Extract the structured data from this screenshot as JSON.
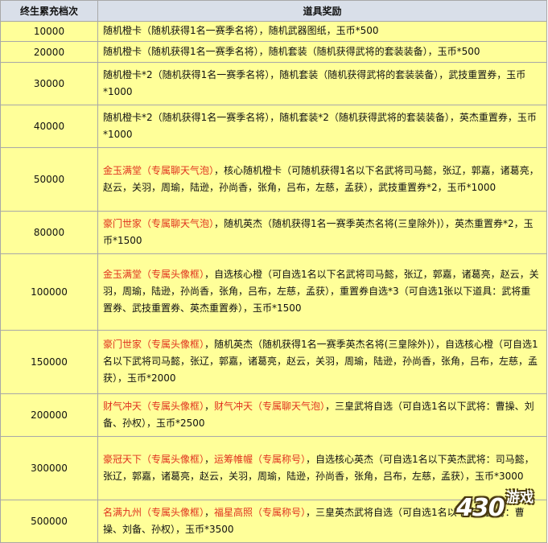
{
  "table": {
    "headers": {
      "tier": "终生累充档次",
      "reward": "道具奖励"
    },
    "rows": [
      {
        "tier": "10000",
        "parts": [
          {
            "t": "随机橙卡（随机获得1名一赛季名将），随机武器图纸，玉币*500"
          }
        ]
      },
      {
        "tier": "20000",
        "parts": [
          {
            "t": "随机橙卡（随机获得1名一赛季名将），随机套装（随机获得武将的套装装备），玉币*500"
          }
        ]
      },
      {
        "tier": "30000",
        "parts": [
          {
            "t": "随机橙卡*2（随机获得1名一赛季名将），随机套装（随机获得武将的套装装备），武技重置券，玉币*1000"
          }
        ]
      },
      {
        "tier": "40000",
        "parts": [
          {
            "t": "随机橙卡*2（随机获得1名一赛季名将），随机套装*2（随机获得武将的套装装备），英杰重置券，玉币*1000"
          }
        ]
      },
      {
        "tier": "50000",
        "parts": [
          {
            "t": "金玉满堂（专属聊天气泡）",
            "hl": true
          },
          {
            "t": "，核心随机橙卡（可随机获得1名以下名武将司马懿，张辽，郭嘉，诸葛亮，赵云，关羽，周瑜，陆逊，孙尚香，张角，吕布，左慈，孟获），武技重置券*2，玉币*1000"
          }
        ]
      },
      {
        "tier": "80000",
        "parts": [
          {
            "t": "豪门世家（专属聊天气泡）",
            "hl": true
          },
          {
            "t": "，随机英杰（随机获得1名一赛季英杰名将(三皇除外)），英杰重置券*2，玉币*1500"
          }
        ]
      },
      {
        "tier": "100000",
        "parts": [
          {
            "t": "金玉满堂（专属头像框）",
            "hl": true
          },
          {
            "t": "，自选核心橙（可自选1名以下名武将司马懿，张辽，郭嘉，诸葛亮，赵云，关羽，周瑜，陆逊，孙尚香，张角，吕布，左慈，孟获），重置券自选*3（可自选1张以下道具：武将重置券、武技重置券、英杰重置券），玉币*1500"
          }
        ]
      },
      {
        "tier": "150000",
        "parts": [
          {
            "t": "豪门世家（专属头像框）",
            "hl": true
          },
          {
            "t": "，随机英杰（随机获得1名一赛季英杰名将(三皇除外)），自选核心橙（可自选1名以下武将司马懿，张辽，郭嘉，诸葛亮，赵云，关羽，周瑜，陆逊，孙尚香，张角，吕布，左慈，孟获），玉币*2000"
          }
        ]
      },
      {
        "tier": "200000",
        "parts": [
          {
            "t": "财气冲天（专属头像框）",
            "hl": true
          },
          {
            "t": "，"
          },
          {
            "t": "财气冲天（专属聊天气泡）",
            "hl": true
          },
          {
            "t": "，三皇武将自选（可自选1名以下武将：曹操、刘备、孙权），玉币*2500"
          }
        ]
      },
      {
        "tier": "300000",
        "parts": [
          {
            "t": "豪冠天下（专属头像框）",
            "hl": true
          },
          {
            "t": "，"
          },
          {
            "t": "运筹帷幄（专属称号）",
            "hl": true
          },
          {
            "t": "，自选核心英杰（可自选1名以下英杰武将：司马懿，张辽，郭嘉，诸葛亮，赵云，关羽，周瑜，陆逊，孙尚香，张角，吕布，左慈，孟获），玉币*3000"
          }
        ]
      },
      {
        "tier": "500000",
        "parts": [
          {
            "t": "名满九州（专属头像框）",
            "hl": true
          },
          {
            "t": "，"
          },
          {
            "t": "福星高照（专属称号）",
            "hl": true
          },
          {
            "t": "，三皇英杰武将自选（可自选1名以下英杰武将：曹操、刘备、孙权），玉币*3500"
          }
        ]
      }
    ]
  },
  "watermark": {
    "num": "430",
    "text": "游戏"
  }
}
